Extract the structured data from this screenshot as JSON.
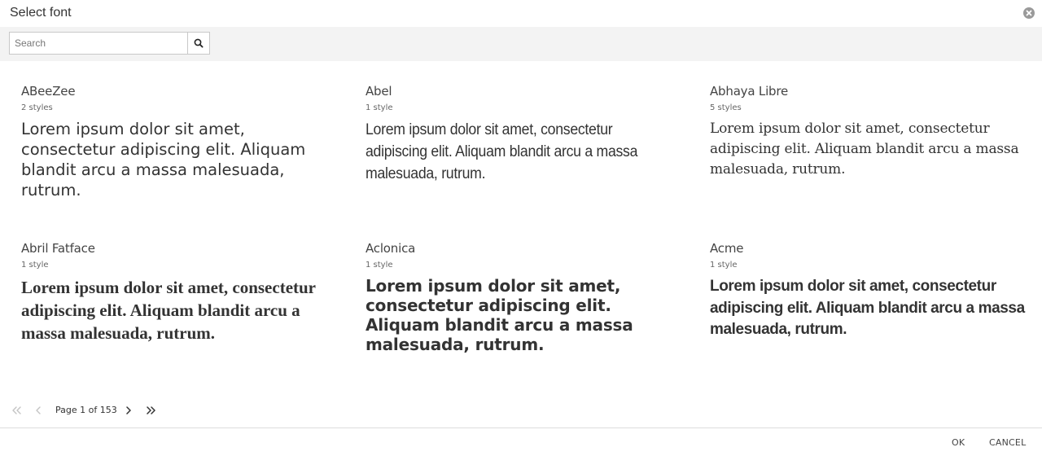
{
  "dialog": {
    "title": "Select font"
  },
  "search": {
    "placeholder": "Search",
    "value": ""
  },
  "fonts": [
    {
      "name": "ABeeZee",
      "styles": "2 styles",
      "sample": "Lorem ipsum dolor sit amet, consectetur adipiscing elit. Aliquam blandit arcu a massa malesuada, rutrum."
    },
    {
      "name": "Abel",
      "styles": "1 style",
      "sample": "Lorem ipsum dolor sit amet, consectetur adipiscing elit. Aliquam blandit arcu a massa malesuada, rutrum."
    },
    {
      "name": "Abhaya Libre",
      "styles": "5 styles",
      "sample": "Lorem ipsum dolor sit amet, consectetur adipiscing elit. Aliquam blandit arcu a massa malesuada, rutrum."
    },
    {
      "name": "Abril Fatface",
      "styles": "1 style",
      "sample": "Lorem ipsum dolor sit amet, consectetur adipiscing elit. Aliquam blandit arcu a massa malesuada, rutrum."
    },
    {
      "name": "Aclonica",
      "styles": "1 style",
      "sample": "Lorem ipsum dolor sit amet, consectetur adipiscing elit. Aliquam blandit arcu a massa malesuada, rutrum."
    },
    {
      "name": "Acme",
      "styles": "1 style",
      "sample": "Lorem ipsum dolor sit amet, consectetur adipiscing elit. Aliquam blandit arcu a massa malesuada, rutrum."
    }
  ],
  "pager": {
    "label": "Page 1 of 153",
    "current_page": 1,
    "total_pages": 153
  },
  "footer": {
    "ok_label": "OK",
    "cancel_label": "CANCEL"
  },
  "icons": {
    "close": "close-icon",
    "search": "search-icon",
    "first": "double-chevron-left-icon",
    "prev": "chevron-left-icon",
    "next": "chevron-right-icon",
    "last": "double-chevron-right-icon"
  }
}
